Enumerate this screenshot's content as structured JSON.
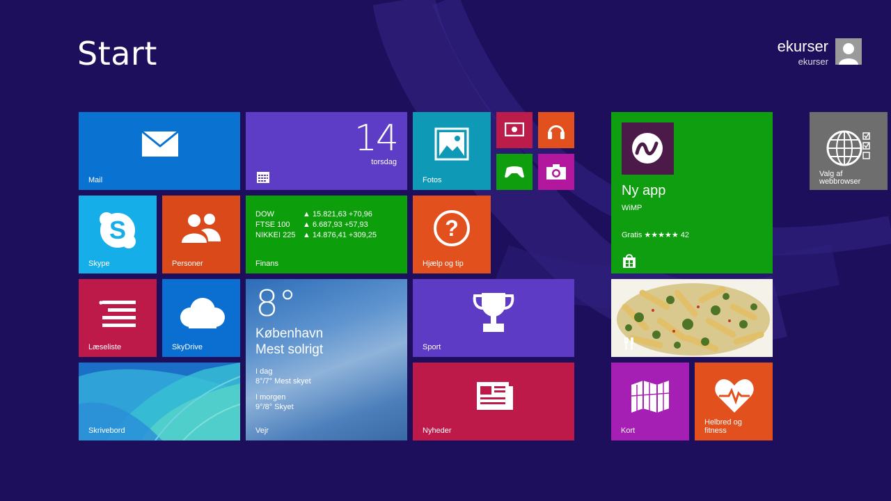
{
  "screen": {
    "title": "Start"
  },
  "user": {
    "name": "ekurser",
    "account": "ekurser"
  },
  "tiles": {
    "mail": {
      "label": "Mail",
      "icon": "mail-icon"
    },
    "calendar": {
      "day": "14",
      "weekday": "torsdag",
      "icon": "calendar-icon"
    },
    "photos": {
      "label": "Fotos",
      "icon": "photos-icon"
    },
    "video": {
      "icon": "video-icon"
    },
    "music": {
      "icon": "headphones-icon"
    },
    "games": {
      "icon": "gamepad-icon"
    },
    "camera": {
      "icon": "camera-icon"
    },
    "skype": {
      "label": "Skype",
      "icon": "skype-icon"
    },
    "people": {
      "label": "Personer",
      "icon": "people-icon"
    },
    "finance": {
      "label": "Finans",
      "rows": [
        {
          "name": "DOW",
          "value": "▲ 15.821,63 +70,96"
        },
        {
          "name": "FTSE 100",
          "value": "▲ 6.687,93 +57,93"
        },
        {
          "name": "NIKKEI 225",
          "value": "▲ 14.876,41 +309,25"
        }
      ]
    },
    "help": {
      "label": "Hjælp og tip",
      "icon": "help-icon"
    },
    "reading_list": {
      "label": "Læseliste",
      "icon": "reading-list-icon"
    },
    "skydrive": {
      "label": "SkyDrive",
      "icon": "cloud-icon"
    },
    "weather": {
      "temp": "8°",
      "city": "København",
      "condition": "Mest solrigt",
      "today_label": "I dag",
      "today_forecast": "8°/7° Mest skyet",
      "tomorrow_label": "I morgen",
      "tomorrow_forecast": "9°/8° Skyet",
      "label": "Vejr"
    },
    "sport": {
      "label": "Sport",
      "icon": "trophy-icon"
    },
    "desktop": {
      "label": "Skrivebord"
    },
    "news": {
      "label": "Nyheder",
      "icon": "newspaper-icon"
    },
    "store": {
      "title": "Ny app",
      "publisher": "WiMP",
      "rating": "Gratis ★★★★★ 42",
      "icon": "store-icon"
    },
    "food": {
      "icon": "fork-knife-icon"
    },
    "maps": {
      "label": "Kort",
      "icon": "map-icon"
    },
    "health": {
      "label_line1": "Helbred og",
      "label_line2": "fitness",
      "icon": "heart-monitor-icon"
    },
    "browser_choice": {
      "label_line1": "Valg af",
      "label_line2": "webbrowser",
      "icon": "globe-checklist-icon"
    }
  }
}
